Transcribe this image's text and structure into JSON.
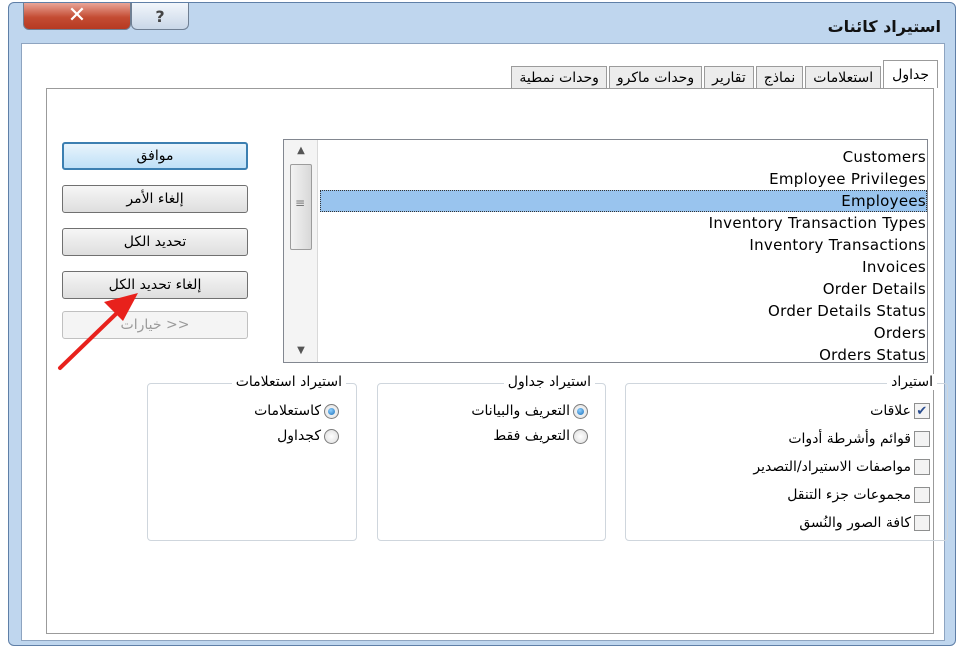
{
  "window": {
    "title": "استيراد كائنات",
    "close_glyph": "✕",
    "help_glyph": "?"
  },
  "tabs": [
    "جداول",
    "استعلامات",
    "نماذج",
    "تقارير",
    "وحدات ماكرو",
    "وحدات نمطية"
  ],
  "list": {
    "items": [
      "Customers",
      "Employee Privileges",
      "Employees",
      "Inventory Transaction Types",
      "Inventory Transactions",
      "Invoices",
      "Order Details",
      "Order Details Status",
      "Orders",
      "Orders Status"
    ],
    "selected": "Employees"
  },
  "buttons": {
    "ok": "موافق",
    "cancel": "إلغاء الأمر",
    "select_all": "تحديد الكل",
    "deselect_all": "إلغاء تحديد الكل",
    "options": "خيارات >>"
  },
  "import_group": {
    "title": "استيراد",
    "items": [
      {
        "label": "علاقات",
        "checked": true
      },
      {
        "label": "قوائم وأشرطة أدوات",
        "checked": false
      },
      {
        "label": "مواصفات الاستيراد/التصدير",
        "checked": false
      },
      {
        "label": "مجموعات جزء التنقل",
        "checked": false
      },
      {
        "label": "كافة الصور والنُسق",
        "checked": false
      }
    ]
  },
  "import_tables_group": {
    "title": "استيراد جداول",
    "options": [
      {
        "label": "التعريف والبيانات",
        "selected": true
      },
      {
        "label": "التعريف فقط",
        "selected": false
      }
    ]
  },
  "import_queries_group": {
    "title": "استيراد استعلامات",
    "options": [
      {
        "label": "كاستعلامات",
        "selected": true
      },
      {
        "label": "كجداول",
        "selected": false
      }
    ]
  },
  "colors": {
    "annotation_arrow": "#e8211c",
    "selection": "#99c4ee"
  }
}
